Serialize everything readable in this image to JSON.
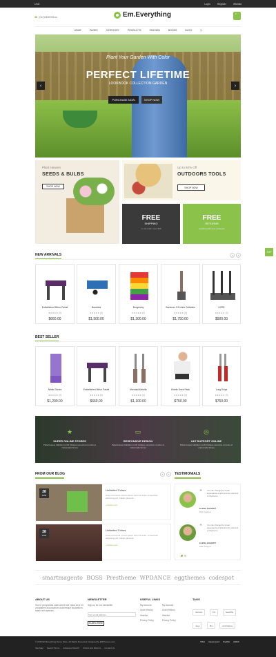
{
  "topbar": {
    "currency": "USD",
    "links": [
      "Login",
      "Register",
      "Wishlist"
    ]
  },
  "header": {
    "phone": "(012)3456789xxx",
    "logo": "Em.Everything",
    "cart_count": "0"
  },
  "nav": [
    "HOME",
    "PAGES",
    "CATEGORY",
    "PRODUCTS",
    "FASHION",
    "BOOKS",
    "BLOG"
  ],
  "hero": {
    "subtitle": "Plant Your Garden With Color",
    "title": "PERFECT LIFETIME",
    "line": "LOOKBOOK COLLECTION GARDEN",
    "btn1": "PURCHASE NOW",
    "btn2": "SHOP NOW"
  },
  "banners": {
    "seeds": {
      "label": "Plant Heaven",
      "title": "SEEDS & BULBS",
      "btn": "SHOP NOW"
    },
    "tools": {
      "label": "Up to 60% Off",
      "title": "OUTDOORS TOOLS",
      "btn": "SHOP NOW"
    },
    "shipping": {
      "title": "FREE",
      "sub": "SHIPPING",
      "desc": "on all orders over $99"
    },
    "returns": {
      "title": "FREE",
      "sub": "RETURNS",
      "desc": "anything with your presence"
    }
  },
  "new_arrivals": {
    "title": "NEW ARRIVALS",
    "items": [
      {
        "name": "Embellished Mirror Pastel",
        "stars": "★★★★★ (0)",
        "price": "$660.00"
      },
      {
        "name": "Barrettes",
        "stars": "★★★★★ (0)",
        "price": "$1,500.00"
      },
      {
        "name": "Burgchesy",
        "stars": "★★★★★ (0)",
        "price": "$1,300.00"
      },
      {
        "name": "Gardener 1.5 Inline Cultivator",
        "stars": "★★★★★ (0)",
        "price": "$1,750.00"
      },
      {
        "name": "HOSE",
        "stars": "★★★★★ (0)",
        "price": "$900.00"
      }
    ]
  },
  "best_seller": {
    "title": "BEST SELLER",
    "items": [
      {
        "name": "Nitrile Gloves",
        "stars": "★★★★★ (0)",
        "price": "$1,200.00"
      },
      {
        "name": "Embellished Mirror Pastel",
        "stars": "★★★★★ (0)",
        "price": "$660.00"
      },
      {
        "name": "Mermaid Metallic",
        "stars": "★★★★★ (0)",
        "price": "$1,100.00"
      },
      {
        "name": "Kinetic Knee Pads",
        "stars": "★★★★★ (0)",
        "price": "$750.00"
      },
      {
        "name": "Long Snips",
        "stars": "★★★★★ (0)",
        "price": "$750.00"
      }
    ]
  },
  "features": [
    {
      "icon": "star-icon",
      "title": "SUPER ONLINE STORES",
      "desc": "Pellentesque habitant morbi tristique senectus et netus et malesuada fames"
    },
    {
      "icon": "monitor-icon",
      "title": "RESPONSIVE DESIGN",
      "desc": "Pellentesque habitant morbi tristique senectus et netus et malesuada fames"
    },
    {
      "icon": "lifebuoy-icon",
      "title": "24/7 SUPPORT ONLINE",
      "desc": "Pellentesque habitant morbi tristique senectus et netus et malesuada fames"
    }
  ],
  "blog": {
    "title": "FROM OUR BLOG",
    "posts": [
      {
        "day": "28",
        "month": "AUG",
        "title": "Unlimited Colors",
        "excerpt": "Cras ut rhoncus. Lorem ipsum dolor sit amet, consectetur adipiscing elit. Nullam placerat.",
        "more": "» Read more"
      },
      {
        "day": "28",
        "month": "AUG",
        "title": "Unlimited Colors",
        "excerpt": "Cras ut rhoncus. Lorem ipsum dolor sit amet, consectetur adipiscing elit. Nullam placerat.",
        "more": "» Read more"
      }
    ]
  },
  "testimonials": {
    "title": "TESTIMONIALS",
    "items": [
      {
        "text": "You can change the visual appearance of almost every element of the theme.",
        "author": "ELENA GILBERT",
        "role": "Web designer"
      },
      {
        "text": "You can change the visual appearance of almost every element of the theme.",
        "author": "ELENA GILBERT",
        "role": "Web designer"
      }
    ]
  },
  "brands": [
    "smartmagento",
    "BOSS",
    "Prestheme",
    "WPDANCE",
    "eggthemes",
    "codespot"
  ],
  "footer": {
    "about": {
      "title": "ABOUT US",
      "text": "Sed ut perspiciatis unde omnis iste natus error sit voluptatem accusantium doloremque laudantium, totam rem aperiam."
    },
    "newsletter": {
      "title": "NEWSLETTER",
      "text": "Sign up for our newsletter",
      "placeholder": "Your email address...",
      "btn": "SUBSCRIBE"
    },
    "useful": {
      "title": "USEFUL LINKS",
      "col1": [
        "My Account",
        "Order History",
        "Wishlist",
        "Privacy Policy"
      ],
      "col2": [
        "My Account",
        "Order History",
        "Wishlist",
        "Privacy Policy"
      ]
    },
    "tags": {
      "title": "TAGS",
      "items": [
        "Aenean",
        "Ant",
        "beautiful",
        "Java",
        "Ma",
        "anti-fatigue"
      ]
    }
  },
  "bottom": {
    "copyright": "© 2015 EM Everything Demo Store. All Rights Reserved. Designed by EMThemes.com",
    "links": [
      "Site Map",
      "Search Terms",
      "Advanced Search",
      "Orders and Returns",
      "Contact Us"
    ],
    "payments": [
      "VISA",
      "mastercard",
      "PayPal",
      "AMEX"
    ]
  },
  "side_tab": "TOP"
}
